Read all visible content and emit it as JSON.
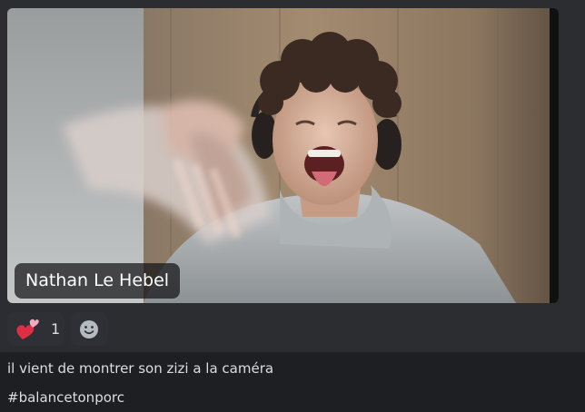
{
  "video": {
    "participant_name": "Nathan Le Hebel"
  },
  "reactions": [
    {
      "emoji": "two-hearts-icon",
      "count": "1"
    }
  ],
  "message": {
    "line1": "il vient de montrer son zizi a la caméra",
    "line2": "#balancetonporc"
  },
  "colors": {
    "background": "#2b2d31",
    "text_area_background": "#1e1f22",
    "reaction_background": "#2e3035",
    "text": "#dbdee1",
    "heart": "#f23f5e"
  }
}
